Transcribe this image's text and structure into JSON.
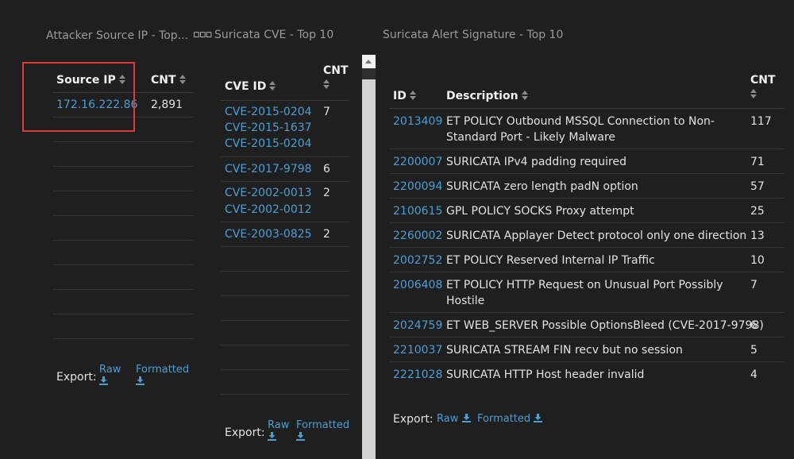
{
  "panels": {
    "attacker": {
      "title": "Attacker Source IP - Top...",
      "menu_icon": "ellipsis-icon",
      "col_ip": "Source IP",
      "col_cnt": "CNT",
      "rows": [
        {
          "ip": "172.16.222.86",
          "cnt": "2,891"
        }
      ],
      "export_label": "Export:",
      "raw_label": "Raw",
      "formatted_label": "Formatted"
    },
    "cve": {
      "title": "Suricata CVE - Top 10",
      "col_id": "CVE ID",
      "col_cnt": "CNT",
      "rows": [
        {
          "ids": [
            "CVE-2015-0204",
            "CVE-2015-1637",
            "CVE-2015-0204"
          ],
          "cnt": "7"
        },
        {
          "ids": [
            "CVE-2017-9798"
          ],
          "cnt": "6"
        },
        {
          "ids": [
            "CVE-2002-0013",
            "CVE-2002-0012"
          ],
          "cnt": "2"
        },
        {
          "ids": [
            "CVE-2003-0825"
          ],
          "cnt": "2"
        }
      ],
      "export_label": "Export:",
      "raw_label": "Raw",
      "formatted_label": "Formatted"
    },
    "signature": {
      "title": "Suricata Alert Signature - Top 10",
      "col_id": "ID",
      "col_desc": "Description",
      "col_cnt": "CNT",
      "rows": [
        {
          "id": "2013409",
          "desc": "ET POLICY Outbound MSSQL Connection to Non-Standard Port - Likely Malware",
          "cnt": "117"
        },
        {
          "id": "2200007",
          "desc": "SURICATA IPv4 padding required",
          "cnt": "71"
        },
        {
          "id": "2200094",
          "desc": "SURICATA zero length padN option",
          "cnt": "57"
        },
        {
          "id": "2100615",
          "desc": "GPL POLICY SOCKS Proxy attempt",
          "cnt": "25"
        },
        {
          "id": "2260002",
          "desc": "SURICATA Applayer Detect protocol only one direction",
          "cnt": "13"
        },
        {
          "id": "2002752",
          "desc": "ET POLICY Reserved Internal IP Traffic",
          "cnt": "10"
        },
        {
          "id": "2006408",
          "desc": "ET POLICY HTTP Request on Unusual Port Possibly Hostile",
          "cnt": "7"
        },
        {
          "id": "2024759",
          "desc": "ET WEB_SERVER Possible OptionsBleed (CVE-2017-9798)",
          "cnt": "6"
        },
        {
          "id": "2210037",
          "desc": "SURICATA STREAM FIN recv but no session",
          "cnt": "5"
        },
        {
          "id": "2221028",
          "desc": "SURICATA HTTP Host header invalid",
          "cnt": "4"
        }
      ],
      "export_label": "Export:",
      "raw_label": "Raw",
      "formatted_label": "Formatted"
    }
  },
  "colors": {
    "background": "#1f1f1f",
    "link": "#4a9fd6",
    "highlight": "#e03b3b"
  }
}
